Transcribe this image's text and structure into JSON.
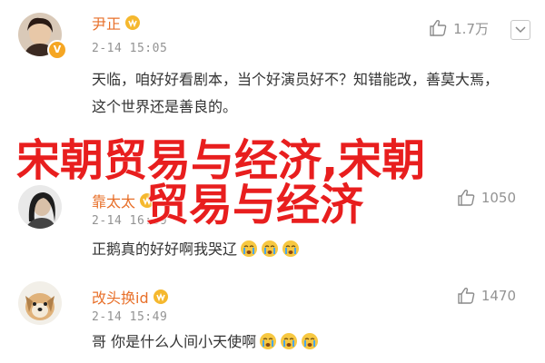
{
  "comments": [
    {
      "username": "尹正",
      "time": "2-14 15:05",
      "text": "天临，咱好好看剧本，当个好演员好不？知错能改，善莫大焉，这个世界还是善良的。",
      "likes": "1.7万",
      "avatar_color": "#6b4a3a"
    },
    {
      "username": "靠太太",
      "time": "2-14 16:39",
      "text": "正鹅真的好好啊我哭辽",
      "likes": "1050",
      "avatar_color": "#5a5a5a"
    },
    {
      "username": "改头换id",
      "time": "2-14 15:49",
      "text": "哥 你是什么人间小天使啊",
      "likes": "1470",
      "avatar_color": "#c8a070"
    }
  ],
  "overlay": {
    "line1": "宋朝贸易与经济,宋朝",
    "line2": "贸易与经济"
  },
  "colors": {
    "username": "#e8702a",
    "overlay": "#e81e1e",
    "meta": "#939393"
  },
  "icons": {
    "like": "thumbs-up-icon",
    "menu": "chevron-down-icon",
    "verified": "vip-badge-icon",
    "cry": "crying-emoji-icon"
  }
}
